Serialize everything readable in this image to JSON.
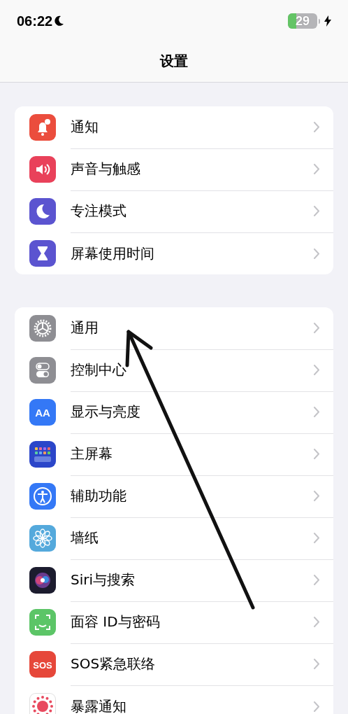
{
  "status_bar": {
    "time": "06:22",
    "focus_moon": true,
    "battery": {
      "percent": "29",
      "level": 0.29,
      "charging": true
    }
  },
  "nav": {
    "title": "设置"
  },
  "groups": [
    {
      "items": [
        {
          "label": "通知",
          "kind": "bell",
          "color": "#eb4d3d"
        },
        {
          "label": "声音与触感",
          "kind": "speaker",
          "color": "#e9415a"
        },
        {
          "label": "专注模式",
          "kind": "moon",
          "color": "#5b54d0"
        },
        {
          "label": "屏幕使用时间",
          "kind": "hourglass",
          "color": "#5b54d0"
        }
      ]
    },
    {
      "items": [
        {
          "label": "通用",
          "kind": "gear",
          "color": "#8e8e93"
        },
        {
          "label": "控制中心",
          "kind": "toggles",
          "color": "#8e8e93"
        },
        {
          "label": "显示与亮度",
          "kind": "text",
          "icon_text": "AA",
          "color": "#3478f6"
        },
        {
          "label": "主屏幕",
          "kind": "grid",
          "color": "#2b46c9"
        },
        {
          "label": "辅助功能",
          "kind": "person",
          "color": "#3478f6"
        },
        {
          "label": "墙纸",
          "kind": "flower",
          "color": "#54a9dc"
        },
        {
          "label": "Siri与搜索",
          "kind": "orb",
          "color": "#1c1c2e"
        },
        {
          "label": "面容 ID与密码",
          "kind": "faceid",
          "color": "#5cc567"
        },
        {
          "label": "SOS紧急联络",
          "kind": "text",
          "icon_text": "SOS",
          "color": "#e6473a"
        },
        {
          "label": "暴露通知",
          "kind": "dots",
          "color": "#ffffff"
        }
      ]
    }
  ],
  "annotation": {
    "kind": "arrow"
  }
}
